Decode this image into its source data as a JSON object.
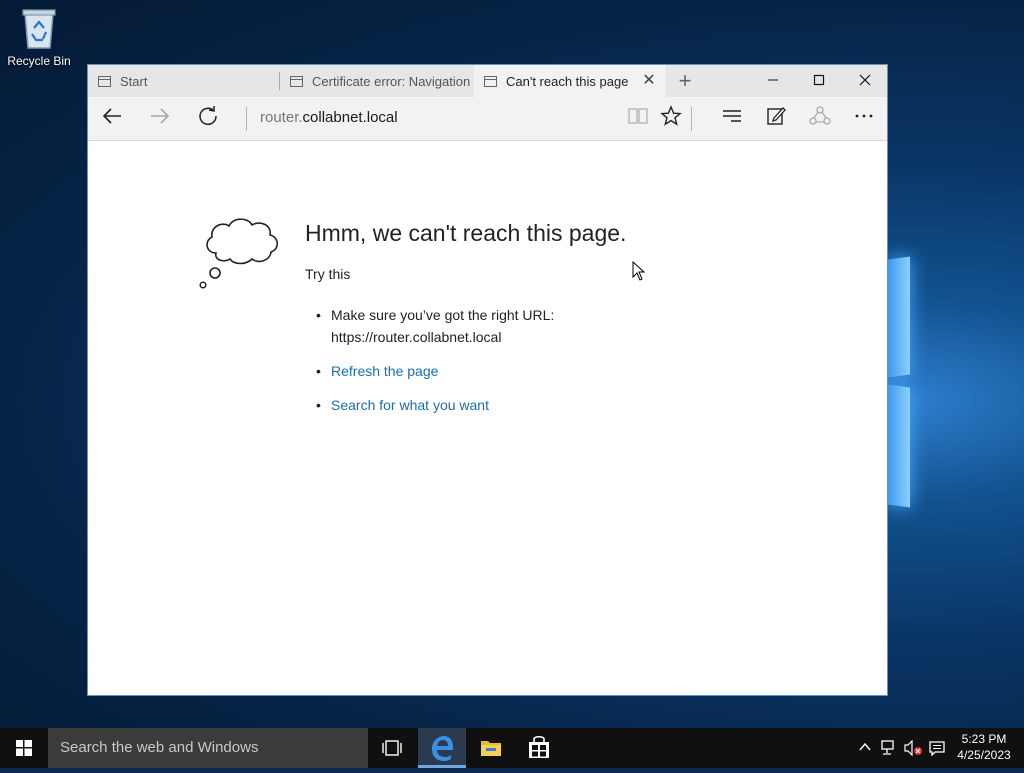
{
  "desktop": {
    "icons": [
      {
        "label": "Recycle Bin",
        "icon": "recycle-bin-icon"
      }
    ]
  },
  "browser": {
    "tabs": [
      {
        "label": "Start",
        "active": false
      },
      {
        "label": "Certificate error: Navigation",
        "active": false
      },
      {
        "label": "Can't reach this page",
        "active": true
      }
    ],
    "address": {
      "subdomain": "router.",
      "domain": "collabnet.local"
    }
  },
  "page": {
    "heading": "Hmm, we can't reach this page.",
    "try_this": "Try this",
    "bullets": {
      "check_url_line1": "Make sure you’ve got the right URL:",
      "check_url_line2": "https://router.collabnet.local",
      "refresh": "Refresh the page",
      "search": "Search for what you want"
    }
  },
  "taskbar": {
    "search_placeholder": "Search the web and Windows",
    "clock": {
      "time": "5:23 PM",
      "date": "4/25/2023"
    }
  },
  "colors": {
    "link": "#1a6fb0",
    "taskbar": "#101010",
    "search_box": "#3b3b3b"
  }
}
